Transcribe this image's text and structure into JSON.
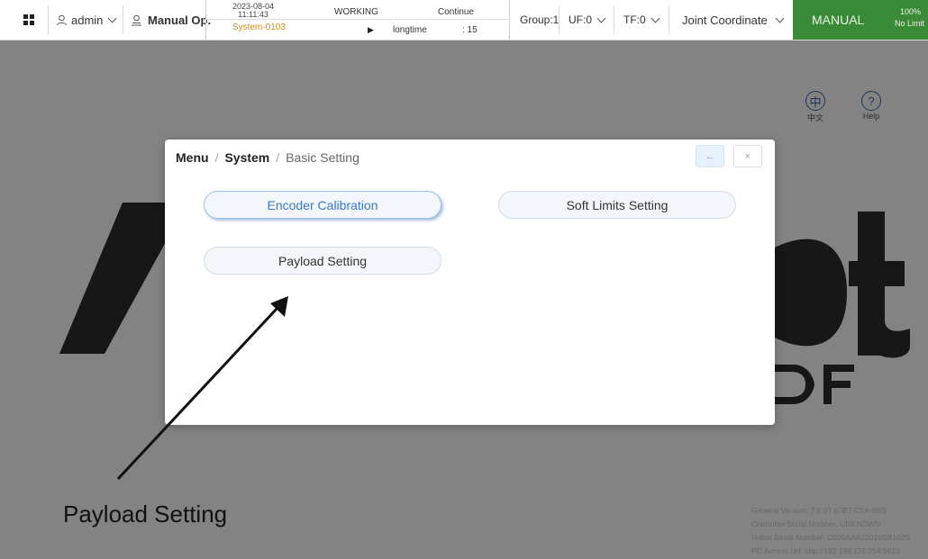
{
  "topbar": {
    "user": "admin",
    "mode": "Manual Op.",
    "datetime": "2023-08-04\n11:11:43",
    "system": "System-0103",
    "state": "WORKING",
    "run_icon": "▶",
    "run_mode": "longtime",
    "continue_label": "Continue",
    "continue_value": ": 15",
    "group": "Group:1",
    "uf": "UF:0",
    "tf": "TF:0",
    "coord": "Joint Coordinate",
    "manual": "MANUAL",
    "speed_pct": "100%",
    "speed_limit": "No Limit"
  },
  "lang": {
    "zh_glyph": "中",
    "zh_label": "中文",
    "help_glyph": "?",
    "help_label": "Help"
  },
  "modal": {
    "crumb_menu": "Menu",
    "crumb_system": "System",
    "crumb_current": "Basic Setting",
    "back_icon": "←",
    "close_icon": "×",
    "buttons": {
      "encoder": "Encoder Calibration",
      "soft_limits": "Soft Limits Setting",
      "payload": "Payload Setting"
    }
  },
  "annotation": "Payload Setting",
  "info": {
    "general": "General Version:  7.0.07 (GBT-C5A-850)",
    "controller": "Controller Serial Number:  UNKNOWN",
    "robot": "Robot Serial Number:  C020AAA22010SB102S",
    "pc": "PC Access Url:  http://192.168.110.254:5613"
  },
  "colors": {
    "manual_bg": "#3b8a35",
    "system_text": "#d48a1a",
    "active_text": "#3a78c8"
  }
}
